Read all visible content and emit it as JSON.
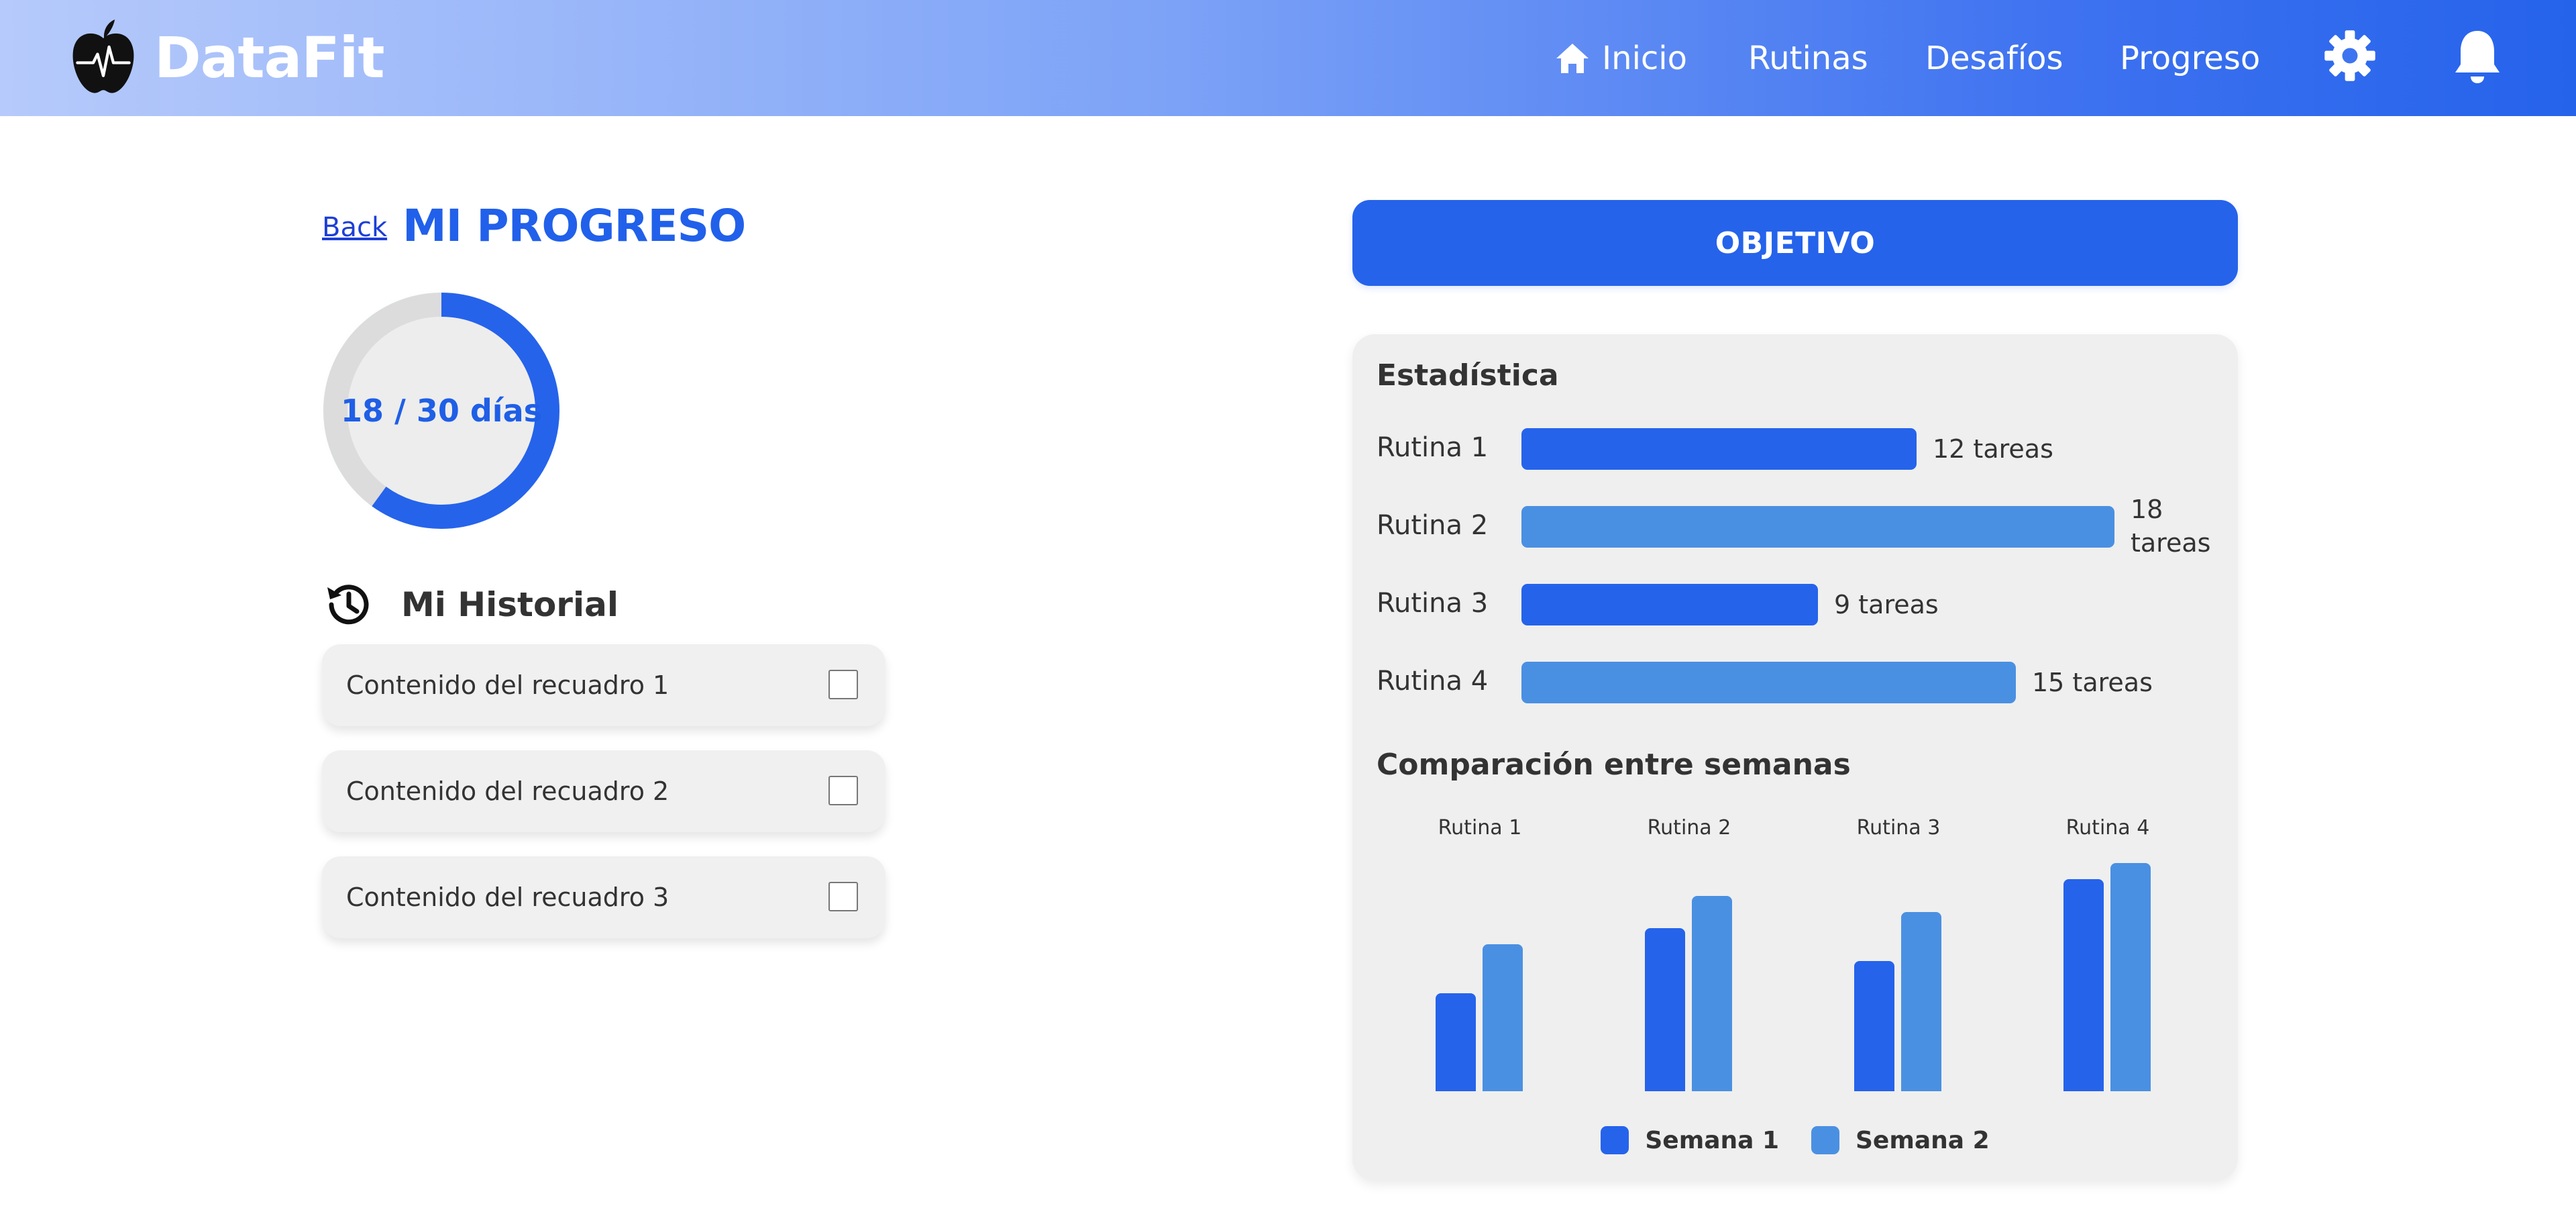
{
  "app": {
    "brand": "DataFit"
  },
  "nav": {
    "items": [
      {
        "label": "Inicio",
        "icon": "home-icon"
      },
      {
        "label": "Rutinas"
      },
      {
        "label": "Desafíos"
      },
      {
        "label": "Progreso"
      }
    ],
    "icons": [
      "gear-icon",
      "bell-icon"
    ]
  },
  "colors": {
    "primary": "#2563eb",
    "secondary": "#4a90e2",
    "card_bg": "#efefef"
  },
  "progress": {
    "back_label": "Back",
    "title": "MI PROGRESO",
    "ring_label": "18 / 30 días",
    "current_days": 18,
    "total_days": 30
  },
  "history": {
    "title": "Mi Historial",
    "icon": "history-icon",
    "items": [
      {
        "text": "Contenido del recuadro 1",
        "checked": false
      },
      {
        "text": "Contenido del recuadro 2",
        "checked": false
      },
      {
        "text": "Contenido del recuadro 3",
        "checked": false
      }
    ]
  },
  "objective": {
    "button_label": "OBJETIVO"
  },
  "stats": {
    "title": "Estadística",
    "comparison_title": "Comparación entre semanas"
  },
  "chart_data": [
    {
      "type": "bar",
      "orientation": "horizontal",
      "title": "Estadística",
      "categories": [
        "Rutina 1",
        "Rutina 2",
        "Rutina 3",
        "Rutina 4"
      ],
      "values": [
        12,
        18,
        9,
        15
      ],
      "value_labels": [
        "12 tareas",
        "18 tareas",
        "9 tareas",
        "15 tareas"
      ],
      "unit": "tareas"
    },
    {
      "type": "bar",
      "title": "Comparación entre semanas",
      "categories": [
        "Rutina 1",
        "Rutina 2",
        "Rutina 3",
        "Rutina 4"
      ],
      "series": [
        {
          "name": "Semana 1",
          "values": [
            6,
            10,
            8,
            13
          ]
        },
        {
          "name": "Semana 2",
          "values": [
            9,
            12,
            11,
            14
          ]
        }
      ],
      "legend": "bottom-center",
      "ylim": [
        0,
        14
      ]
    }
  ]
}
